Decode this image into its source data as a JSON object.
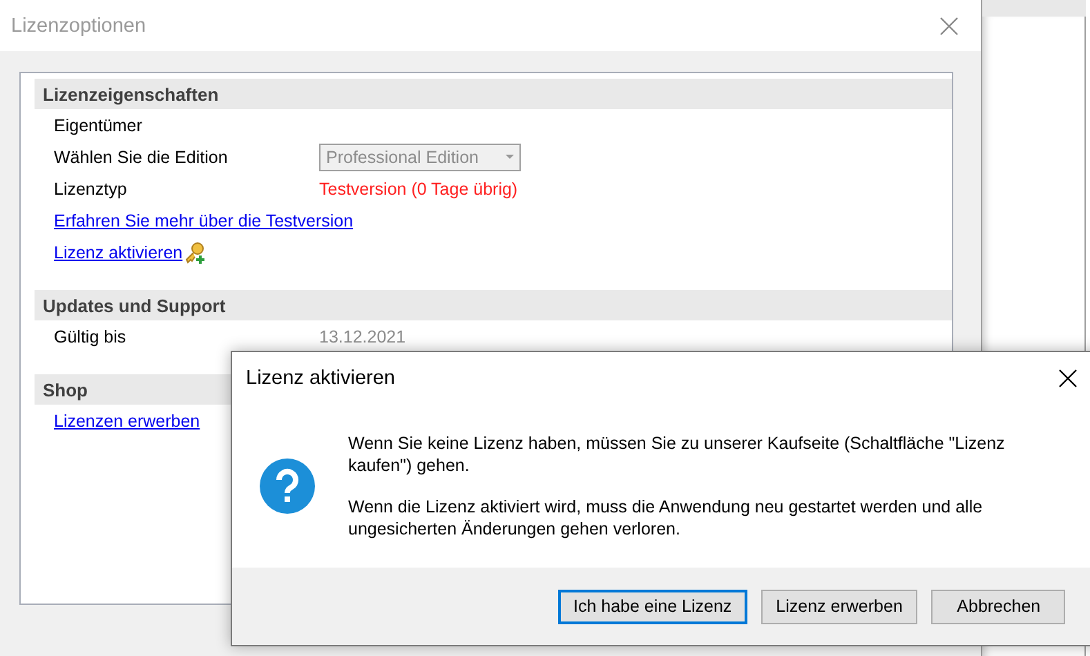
{
  "main_window": {
    "title": "Lizenzoptionen",
    "sections": [
      {
        "title": "Lizenzeigenschaften",
        "rows": [
          {
            "kind": "field",
            "label": "Eigentümer"
          },
          {
            "kind": "dropdown",
            "label": "Wählen Sie die Edition",
            "value": "Professional Edition",
            "disabled": true
          },
          {
            "kind": "status",
            "label": "Lizenztyp",
            "value": "Testversion (0 Tage übrig)"
          },
          {
            "kind": "link",
            "label": "Erfahren Sie mehr über die Testversion"
          },
          {
            "kind": "key_link",
            "label": "Lizenz aktivieren"
          }
        ]
      },
      {
        "title": "Updates und Support",
        "rows": [
          {
            "kind": "field",
            "label": "Gültig bis",
            "value": "13.12.2021"
          }
        ]
      },
      {
        "title": "Shop",
        "rows": [
          {
            "kind": "link",
            "label": "Lizenzen erwerben"
          }
        ]
      }
    ]
  },
  "dialog": {
    "title": "Lizenz aktivieren",
    "messages": [
      "Wenn Sie keine Lizenz haben, müssen Sie zu unserer Kaufseite (Schaltfläche \"Lizenz kaufen\") gehen.",
      "Wenn die Lizenz aktiviert wird, muss die Anwendung neu gestartet werden und alle ungesicherten Änderungen gehen verloren."
    ],
    "buttons": [
      {
        "label": "Ich habe eine Lizenz",
        "default": true
      },
      {
        "label": "Lizenz erwerben",
        "default": false
      },
      {
        "label": "Abbrechen",
        "default": false
      }
    ]
  }
}
